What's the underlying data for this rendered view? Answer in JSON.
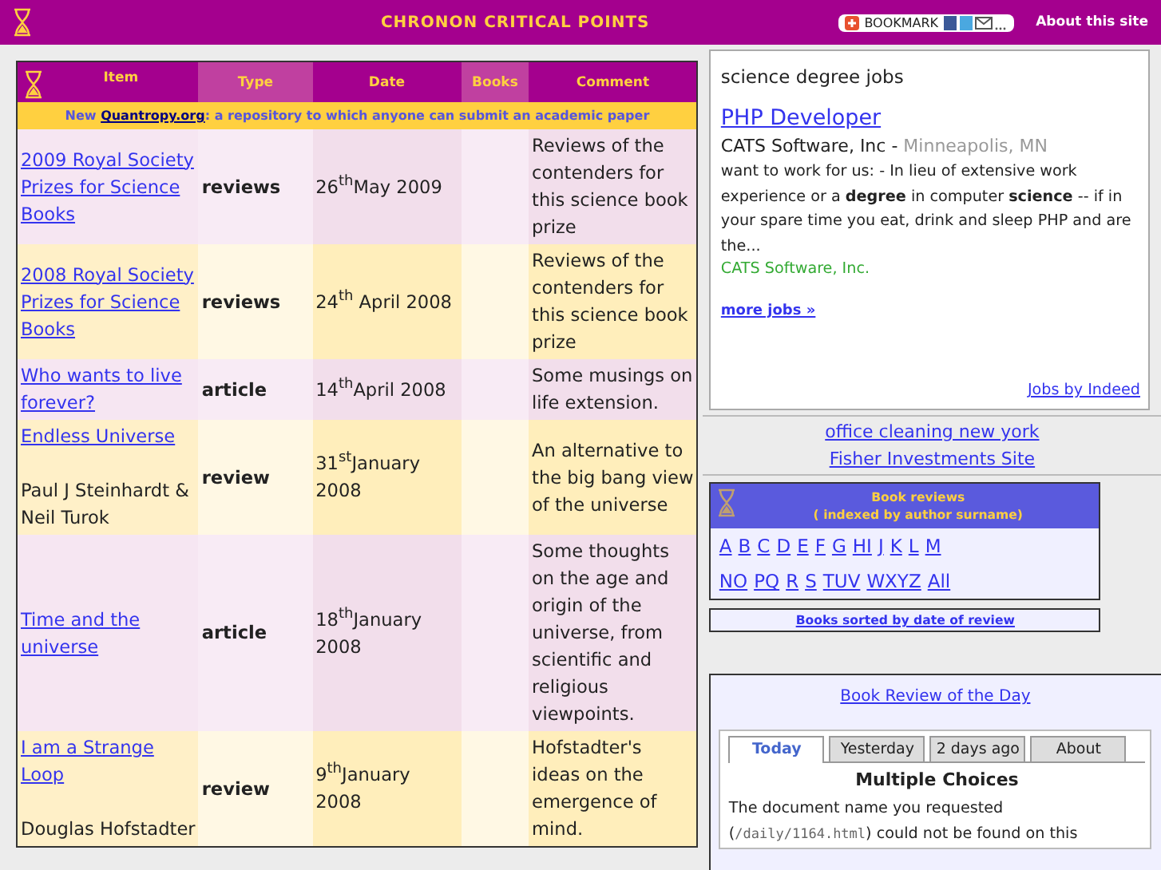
{
  "header": {
    "title": "CHRONON CRITICAL POINTS",
    "bookmark": "BOOKMARK",
    "about": "About this site"
  },
  "table": {
    "columns": [
      {
        "label": "Item",
        "shaded": false
      },
      {
        "label": "Type",
        "shaded": true
      },
      {
        "label": "Date",
        "shaded": false
      },
      {
        "label": "Books",
        "shaded": true
      },
      {
        "label": "Comment",
        "shaded": false
      }
    ],
    "notice": {
      "prefix": "New",
      "link": "Quantropy.org",
      "suffix": ": a repository to which anyone can submit an academic paper"
    },
    "rows": [
      {
        "title": "2009 Royal Society Prizes for Science Books",
        "type": "reviews",
        "date": "26$^{th}$May 2009",
        "comment": "Reviews of the contenders for this science book prize"
      },
      {
        "title": "2008 Royal Society Prizes for Science Books",
        "type": "reviews",
        "date": "24$^{th}$ April 2008",
        "comment": "Reviews of the contenders for this science book prize"
      },
      {
        "title": "Who wants to live forever?",
        "type": "article",
        "date": "14$^{th}$April 2008",
        "comment": "Some musings on life extension."
      },
      {
        "title": "Endless Universe ",
        "author": "Paul J Steinhardt & Neil Turok",
        "type": "review",
        "date": "31$^{st}$January 2008",
        "comment": "An alternative to the big bang view of the universe"
      },
      {
        "title": "Time and the universe",
        "type": "article",
        "date": "18$^{th}$January 2008",
        "comment": "Some thoughts on the age and origin of the universe, from scientific and religious viewpoints."
      },
      {
        "title": "I am a Strange Loop",
        "author": "Douglas Hofstadter",
        "type": "review",
        "date": "9$^{th}$January 2008",
        "comment": "Hofstadter's ideas on the emergence of mind."
      }
    ]
  },
  "jobs": {
    "heading": "science degree jobs",
    "job_title": "PHP Developer",
    "company": "CATS Software, Inc -",
    "location": "Minneapolis, MN",
    "snippet": "want to work for us: - In lieu of extensive work experience or a **degree** in computer **science** -- if in your spare time you eat, drink and sleep PHP and are the...",
    "source": "CATS Software, Inc.",
    "more": "more jobs »",
    "credit": "Jobs by Indeed"
  },
  "ad_links": [
    "office cleaning new york",
    "Fisher Investments Site"
  ],
  "book_index": {
    "title": "Book reviews",
    "subtitle": "( indexed by author surname)",
    "letter_rows": [
      [
        "A",
        "B",
        "C",
        "D",
        "E",
        "F",
        "G",
        "HI",
        "J",
        "K",
        "L",
        "M"
      ],
      [
        "NO",
        "PQ",
        "R",
        "S",
        "TUV",
        "WXYZ",
        "All"
      ]
    ]
  },
  "sorted_link": "Books sorted by date of review",
  "review_of_day": {
    "title": "Book Review of the Day",
    "tabs": [
      {
        "label": "Today",
        "selected": true
      },
      {
        "label": "Yesterday",
        "selected": false
      },
      {
        "label": "2 days ago",
        "selected": false
      },
      {
        "label": "About",
        "selected": false
      }
    ],
    "heading": "Multiple Choices",
    "message_start": "The document name you requested (",
    "path": "/daily/1164.html",
    "message_end": ") could not be found on this"
  }
}
